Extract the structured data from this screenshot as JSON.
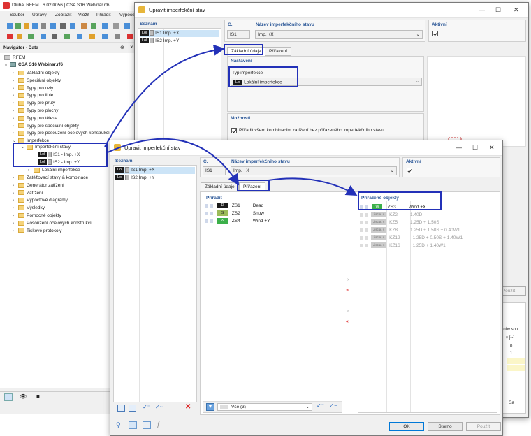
{
  "main": {
    "title": "Dlubal RFEM | 6.02.0056 | CSA S16 Webinar.rf6",
    "menu": [
      "Soubor",
      "Úpravy",
      "Zobrazit",
      "Vložit",
      "Přiřadit",
      "Výpočet"
    ]
  },
  "navigator": {
    "title": "Navigátor - Data",
    "root": "RFEM",
    "model": "CSA S16 Webinar.rf6",
    "items": [
      "Základní objekty",
      "Speciální objekty",
      "Typy pro uzly",
      "Typy pro linie",
      "Typy pro pruty",
      "Typy pro plochy",
      "Typy pro tělesa",
      "Typy pro speciální objekty",
      "Typy pro posouzení ocelových konstrukcí",
      "Imperfekce"
    ],
    "imperf_group": "Imperfekční stavy",
    "imperf_cases": [
      {
        "tag": "Lol",
        "label": "IS1 - Imp. +X"
      },
      {
        "tag": "Lol",
        "label": "IS2 - Imp. +Y"
      }
    ],
    "local_imperf": "Lokální imperfekce",
    "items_after": [
      "Zatěžovací stavy & kombinace",
      "Generátor zatížení",
      "Zatížení",
      "Výpočtové diagramy",
      "Výsledky",
      "Pomocné objekty",
      "Posouzení ocelových konstrukcí",
      "Tiskové protokoly"
    ]
  },
  "dialog_back": {
    "title": "Upravit imperfekční stav",
    "list_label": "Seznam",
    "list": [
      {
        "tag": "Lol",
        "id": "IS1",
        "name": "Imp. +X"
      },
      {
        "tag": "Lol",
        "id": "IS2",
        "name": "Imp. +Y"
      }
    ],
    "no_label": "Č.",
    "no_value": "IS1",
    "name_label": "Název imperfekčního stavu",
    "name_value": "Imp. +X",
    "active_label": "Aktivní",
    "tabs": [
      "Základní údaje",
      "Přiřazení"
    ],
    "settings_label": "Nastavení",
    "type_label": "Typ imperfekce",
    "type_tag": "Lol",
    "type_value": "Lokální imperfekce",
    "options_label": "Možnosti",
    "option_text": "Přiřadit všem kombinacím zatížení bez přiřazeného imperfekčního stavu",
    "apply": "Použít",
    "right_fragments": [
      "onův sou",
      "v [--]",
      "0...",
      "1..."
    ],
    "sa": "Sa"
  },
  "dialog_front": {
    "title": "Upravit imperfekční stav",
    "list_label": "Seznam",
    "list": [
      {
        "tag": "Lol",
        "id": "IS1",
        "name": "Imp. +X"
      },
      {
        "tag": "Lol",
        "id": "IS2",
        "name": "Imp. +Y"
      }
    ],
    "no_label": "Č.",
    "no_value": "IS1",
    "name_label": "Název imperfekčního stavu",
    "name_value": "Imp. +X",
    "active_label": "Aktivní",
    "tabs": [
      "Základní údaje",
      "Přiřazení"
    ],
    "assign_label": "Přiřadit",
    "assign_rows": [
      {
        "tag": "D",
        "color": "#1b1b1b",
        "text": "#fff",
        "id": "ZS1",
        "name": "Dead"
      },
      {
        "tag": "S",
        "color": "#9bbb59",
        "text": "#222",
        "id": "ZS2",
        "name": "Snow"
      },
      {
        "tag": "W",
        "color": "#3cb04a",
        "text": "#fff",
        "id": "ZS4",
        "name": "Wind +Y"
      }
    ],
    "assigned_label": "Přiřazené objekty",
    "assigned_first": {
      "tag": "W",
      "id": "ZS3",
      "name": "Wind +X"
    },
    "assigned_rows": [
      {
        "tag": "Jiscor. s",
        "id": "KZ2",
        "name": "1.40D"
      },
      {
        "tag": "Jiscor. s",
        "id": "KZ5",
        "name": "1.25D + 1.50S"
      },
      {
        "tag": "Jiscor. s",
        "id": "KZ8",
        "name": "1.25D + 1.50S + 0.40W1"
      },
      {
        "tag": "Jiscor. s",
        "id": "KZ12",
        "name": "1.25D + 0.50S + 1.40W1"
      },
      {
        "tag": "Jiscor. s",
        "id": "KZ16",
        "name": "1.25D + 1.40W1"
      }
    ],
    "filter_value": "Vše (3)",
    "ok": "OK",
    "cancel": "Storno",
    "apply": "Použít"
  },
  "colors": {
    "highlight": "#2331b8",
    "accent": "#0078d7",
    "selection": "#cce4f7"
  }
}
